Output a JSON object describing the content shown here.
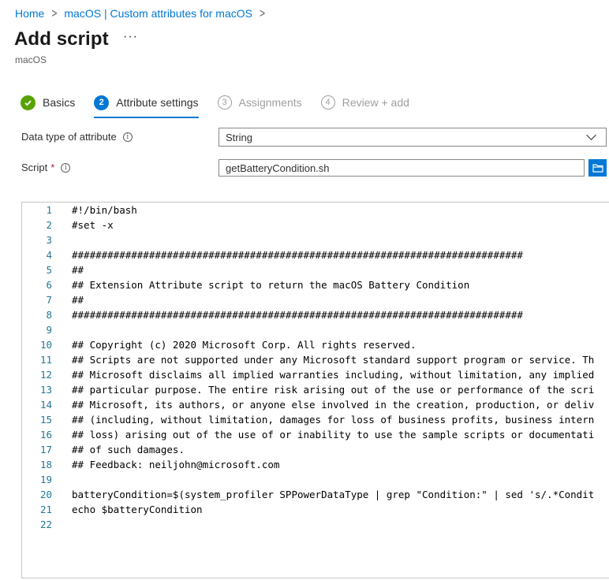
{
  "breadcrumb": {
    "items": [
      "Home",
      "macOS | Custom attributes for macOS"
    ]
  },
  "header": {
    "title": "Add script",
    "more": "···",
    "subtitle": "macOS"
  },
  "steps": [
    {
      "number": "✓",
      "label": "Basics",
      "state": "done"
    },
    {
      "number": "2",
      "label": "Attribute settings",
      "state": "active"
    },
    {
      "number": "3",
      "label": "Assignments",
      "state": "pending"
    },
    {
      "number": "4",
      "label": "Review + add",
      "state": "pending"
    }
  ],
  "form": {
    "data_type_label": "Data type of attribute",
    "data_type_value": "String",
    "script_label": "Script",
    "required_mark": "*",
    "script_file": "getBatteryCondition.sh"
  },
  "editor": {
    "lines": [
      {
        "n": "1",
        "t": "#!/bin/bash"
      },
      {
        "n": "2",
        "t": "#set -x"
      },
      {
        "n": "3",
        "t": ""
      },
      {
        "n": "4",
        "t": "############################################################################"
      },
      {
        "n": "5",
        "t": "##"
      },
      {
        "n": "6",
        "t": "## Extension Attribute script to return the macOS Battery Condition"
      },
      {
        "n": "7",
        "t": "##"
      },
      {
        "n": "8",
        "t": "############################################################################"
      },
      {
        "n": "9",
        "t": ""
      },
      {
        "n": "10",
        "t": "## Copyright (c) 2020 Microsoft Corp. All rights reserved."
      },
      {
        "n": "11",
        "t": "## Scripts are not supported under any Microsoft standard support program or service. Th"
      },
      {
        "n": "12",
        "t": "## Microsoft disclaims all implied warranties including, without limitation, any implied"
      },
      {
        "n": "13",
        "t": "## particular purpose. The entire risk arising out of the use or performance of the scri"
      },
      {
        "n": "14",
        "t": "## Microsoft, its authors, or anyone else involved in the creation, production, or deliv"
      },
      {
        "n": "15",
        "t": "## (including, without limitation, damages for loss of business profits, business intern"
      },
      {
        "n": "16",
        "t": "## loss) arising out of the use of or inability to use the sample scripts or documentati"
      },
      {
        "n": "17",
        "t": "## of such damages."
      },
      {
        "n": "18",
        "t": "## Feedback: neiljohn@microsoft.com"
      },
      {
        "n": "19",
        "t": ""
      },
      {
        "n": "20",
        "t": "batteryCondition=$(system_profiler SPPowerDataType | grep \"Condition:\" | sed 's/.*Condit"
      },
      {
        "n": "21",
        "t": "echo $batteryCondition"
      },
      {
        "n": "22",
        "t": ""
      }
    ]
  }
}
